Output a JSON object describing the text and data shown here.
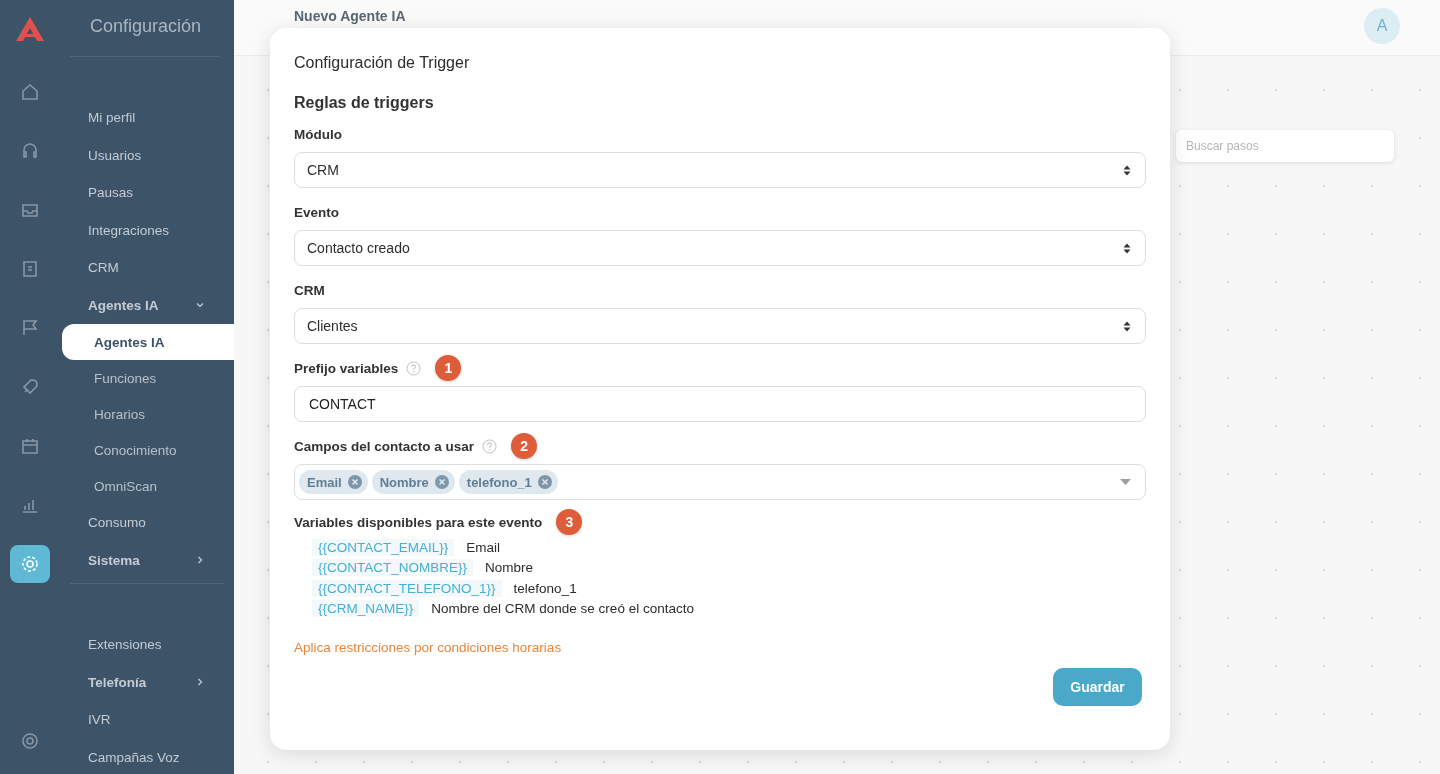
{
  "rail": [
    {
      "selected": false
    },
    {
      "selected": false
    },
    {
      "selected": false
    },
    {
      "selected": false
    },
    {
      "selected": false
    },
    {
      "selected": false
    },
    {
      "selected": false
    },
    {
      "selected": false
    },
    {
      "selected": true
    },
    {
      "selected": false
    }
  ],
  "sidebar": {
    "title": "Configuración",
    "sections": [
      {
        "items": [
          {
            "kind": "link",
            "label": "Mi perfil",
            "selected": false
          },
          {
            "kind": "link",
            "label": "Usuarios",
            "selected": false
          },
          {
            "kind": "link",
            "label": "Pausas",
            "selected": false
          },
          {
            "kind": "link",
            "label": "Integraciones",
            "selected": false
          },
          {
            "kind": "link",
            "label": "CRM",
            "selected": false
          },
          {
            "kind": "group",
            "label": "Agentes IA",
            "expanded": true,
            "children": [
              {
                "label": "Agentes IA",
                "selected": true
              },
              {
                "label": "Funciones",
                "selected": false
              },
              {
                "label": "Horarios",
                "selected": false
              },
              {
                "label": "Conocimiento",
                "selected": false
              },
              {
                "label": "OmniScan",
                "selected": false
              }
            ]
          },
          {
            "kind": "link",
            "label": "Consumo",
            "selected": false
          },
          {
            "kind": "group",
            "label": "Sistema",
            "expanded": false
          }
        ]
      },
      {
        "items": [
          {
            "kind": "link",
            "label": "Extensiones",
            "selected": false
          },
          {
            "kind": "group",
            "label": "Telefonía",
            "expanded": false
          },
          {
            "kind": "link",
            "label": "IVR",
            "selected": false
          },
          {
            "kind": "link",
            "label": "Campañas Voz",
            "selected": false
          }
        ]
      }
    ]
  },
  "header": {
    "title": "Nuevo Agente IA",
    "avatar": "A"
  },
  "search": {
    "placeholder": "Buscar pasos"
  },
  "modal": {
    "title": "Configuración de Trigger",
    "section": "Reglas de triggers",
    "fields": [
      {
        "kind": "select",
        "label": "Módulo",
        "value": "CRM",
        "help": false
      },
      {
        "kind": "select",
        "label": "Evento",
        "value": "Contacto creado",
        "help": false
      },
      {
        "kind": "select",
        "label": "CRM",
        "value": "Clientes",
        "help": false
      },
      {
        "kind": "text",
        "label": "Prefijo variables",
        "value": "CONTACT",
        "help": true,
        "badge": "1"
      },
      {
        "kind": "tags",
        "label": "Campos del contacto a usar",
        "help": true,
        "badge": "2",
        "tags": [
          "Email",
          "Nombre",
          "telefono_1"
        ]
      }
    ],
    "variables": {
      "label": "Variables disponibles para este evento",
      "badge": "3",
      "rows": [
        {
          "token": "{{CONTACT_EMAIL}}",
          "description": "Email"
        },
        {
          "token": "{{CONTACT_NOMBRE}}",
          "description": "Nombre"
        },
        {
          "token": "{{CONTACT_TELEFONO_1}}",
          "description": "telefono_1"
        },
        {
          "token": "{{CRM_NAME}}",
          "description": "Nombre del CRM donde se creó el contacto"
        }
      ]
    },
    "link": "Aplica restricciones por condiciones horarias",
    "button": "Guardar"
  }
}
